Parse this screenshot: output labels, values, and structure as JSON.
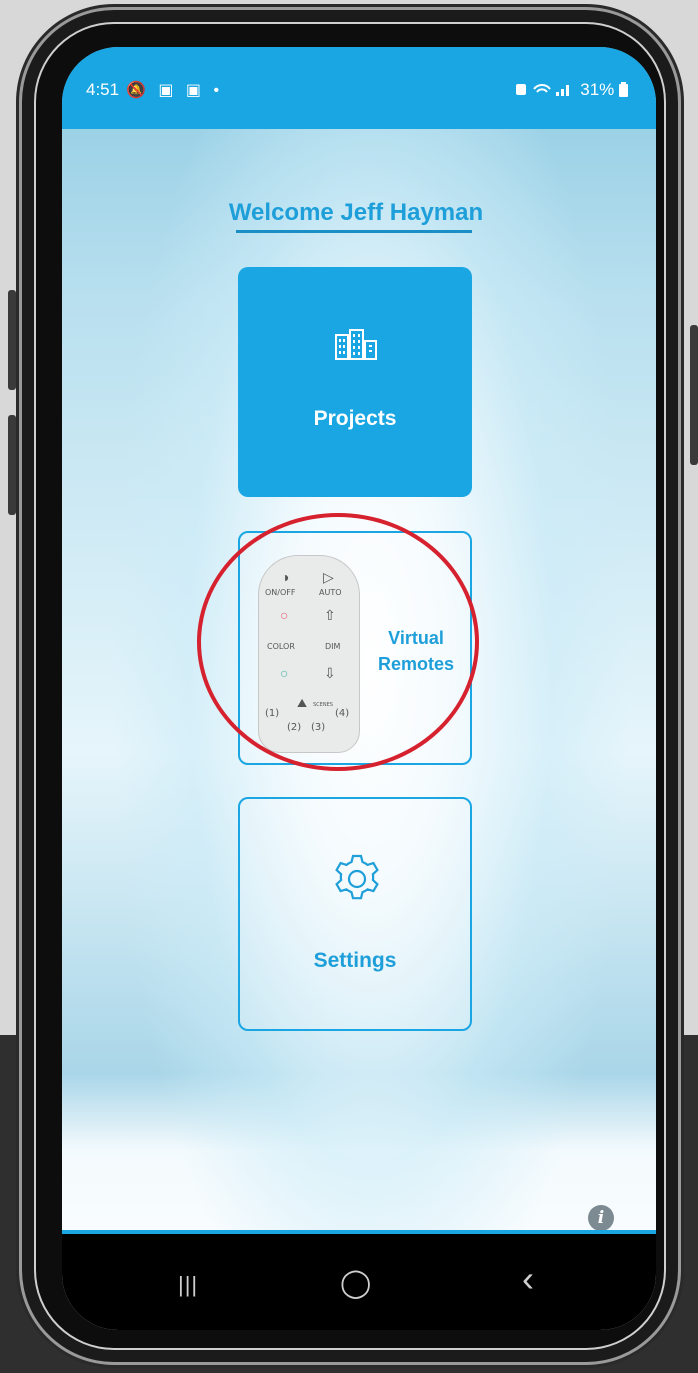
{
  "status_bar": {
    "time": "4:51",
    "left_icons": "🔕 ▣ ▣ •",
    "right_status": "31%"
  },
  "welcome": {
    "title": "Welcome Jeff Hayman"
  },
  "menu": {
    "projects_label": "Projects",
    "virtual_remotes_label_line1": "Virtual",
    "virtual_remotes_label_line2": "Remotes",
    "settings_label": "Settings"
  },
  "remote_image": {
    "on_off": "ON/OFF",
    "auto": "AUTO",
    "color": "COLOR",
    "dim": "DIM",
    "scenes": "SCENES",
    "s1": "1",
    "s2": "2",
    "s3": "3",
    "s4": "4"
  },
  "nav": {
    "recents": "|||",
    "home": "◯",
    "back": "‹"
  },
  "info": {
    "glyph": "i"
  },
  "colors": {
    "accent": "#1aa6e2",
    "annotation": "#d6212e"
  }
}
